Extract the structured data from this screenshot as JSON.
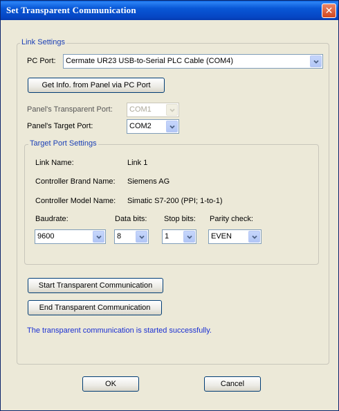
{
  "window": {
    "title": "Set Transparent Communication"
  },
  "link_settings": {
    "group_label": "Link Settings",
    "pc_port_label": "PC Port:",
    "pc_port_value": "Cermate UR23 USB-to-Serial PLC Cable (COM4)",
    "get_info_button": "Get Info. from Panel via PC Port",
    "transparent_port_label": "Panel's Transparent Port:",
    "transparent_port_value": "COM1",
    "target_port_label": "Panel's Target Port:",
    "target_port_value": "COM2"
  },
  "target_port_settings": {
    "group_label": "Target Port Settings",
    "link_name_label": "Link Name:",
    "link_name_value": "Link 1",
    "brand_label": "Controller Brand Name:",
    "brand_value": "Siemens AG",
    "model_label": "Controller Model Name:",
    "model_value": "Simatic S7-200 (PPI; 1-to-1)",
    "baudrate_label": "Baudrate:",
    "baudrate_value": "9600",
    "data_bits_label": "Data bits:",
    "data_bits_value": "8",
    "stop_bits_label": "Stop bits:",
    "stop_bits_value": "1",
    "parity_label": "Parity check:",
    "parity_value": "EVEN"
  },
  "actions": {
    "start_button": "Start Transparent Communication",
    "end_button": "End Transparent Communication",
    "status_message": "The transparent communication is started successfully.",
    "ok_button": "OK",
    "cancel_button": "Cancel"
  },
  "icons": {
    "close": "close-icon",
    "dropdown": "chevron-down-icon"
  },
  "colors": {
    "titlebar": "#0857d6",
    "close_button": "#d2471e",
    "group_label": "#1a3fb5",
    "status_text": "#1a2fd2",
    "dialog_bg": "#ece9d8"
  }
}
